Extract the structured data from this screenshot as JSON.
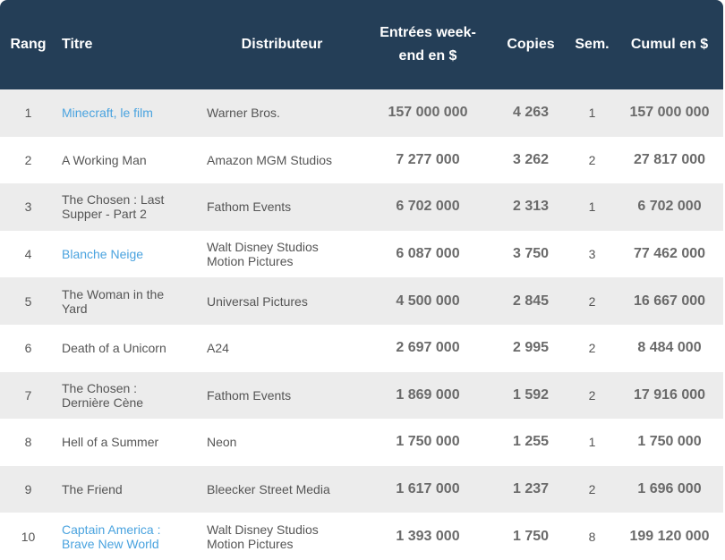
{
  "table": {
    "headers": {
      "rank": "Rang",
      "title": "Titre",
      "distributor": "Distributeur",
      "weekend_line1": "Entrées week-",
      "weekend_line2": "end en $",
      "copies": "Copies",
      "weeks": "Sem.",
      "cumul": "Cumul en $"
    },
    "rows": [
      {
        "rank": "1",
        "title_line1": "Minecraft, le film",
        "title_line2": "",
        "linked": true,
        "dist_line1": "Warner Bros.",
        "dist_line2": "",
        "weekend": "157 000 000",
        "copies": "4 263",
        "weeks": "1",
        "cumul": "157 000 000"
      },
      {
        "rank": "2",
        "title_line1": "A Working Man",
        "title_line2": "",
        "linked": false,
        "dist_line1": "Amazon MGM Studios",
        "dist_line2": "",
        "weekend": "7 277 000",
        "copies": "3 262",
        "weeks": "2",
        "cumul": "27 817 000"
      },
      {
        "rank": "3",
        "title_line1": "The Chosen : Last",
        "title_line2": "Supper - Part 2",
        "linked": false,
        "dist_line1": "Fathom Events",
        "dist_line2": "",
        "weekend": "6 702 000",
        "copies": "2 313",
        "weeks": "1",
        "cumul": "6 702 000"
      },
      {
        "rank": "4",
        "title_line1": "Blanche Neige",
        "title_line2": "",
        "linked": true,
        "dist_line1": "Walt Disney Studios",
        "dist_line2": "Motion Pictures",
        "weekend": "6 087 000",
        "copies": "3 750",
        "weeks": "3",
        "cumul": "77 462 000"
      },
      {
        "rank": "5",
        "title_line1": "The Woman in the",
        "title_line2": "Yard",
        "linked": false,
        "dist_line1": "Universal Pictures",
        "dist_line2": "",
        "weekend": "4 500 000",
        "copies": "2 845",
        "weeks": "2",
        "cumul": "16 667 000"
      },
      {
        "rank": "6",
        "title_line1": "Death of a Unicorn",
        "title_line2": "",
        "linked": false,
        "dist_line1": "A24",
        "dist_line2": "",
        "weekend": "2 697 000",
        "copies": "2 995",
        "weeks": "2",
        "cumul": "8 484 000"
      },
      {
        "rank": "7",
        "title_line1": "The Chosen :",
        "title_line2": "Dernière Cène",
        "linked": false,
        "dist_line1": "Fathom Events",
        "dist_line2": "",
        "weekend": "1 869 000",
        "copies": "1 592",
        "weeks": "2",
        "cumul": "17 916 000"
      },
      {
        "rank": "8",
        "title_line1": "Hell of a Summer",
        "title_line2": "",
        "linked": false,
        "dist_line1": "Neon",
        "dist_line2": "",
        "weekend": "1 750 000",
        "copies": "1 255",
        "weeks": "1",
        "cumul": "1 750 000"
      },
      {
        "rank": "9",
        "title_line1": "The Friend",
        "title_line2": "",
        "linked": false,
        "dist_line1": "Bleecker Street Media",
        "dist_line2": "",
        "weekend": "1 617 000",
        "copies": "1 237",
        "weeks": "2",
        "cumul": "1 696 000"
      },
      {
        "rank": "10",
        "title_line1": "Captain America :",
        "title_line2": "Brave New World",
        "linked": true,
        "dist_line1": "Walt Disney Studios",
        "dist_line2": "Motion Pictures",
        "weekend": "1 393 000",
        "copies": "1 750",
        "weeks": "8",
        "cumul": "199 120 000"
      }
    ]
  },
  "colors": {
    "header_bg": "#243e57",
    "row_alt_bg": "#ececec",
    "link": "#4aa3df",
    "text": "#555555"
  }
}
